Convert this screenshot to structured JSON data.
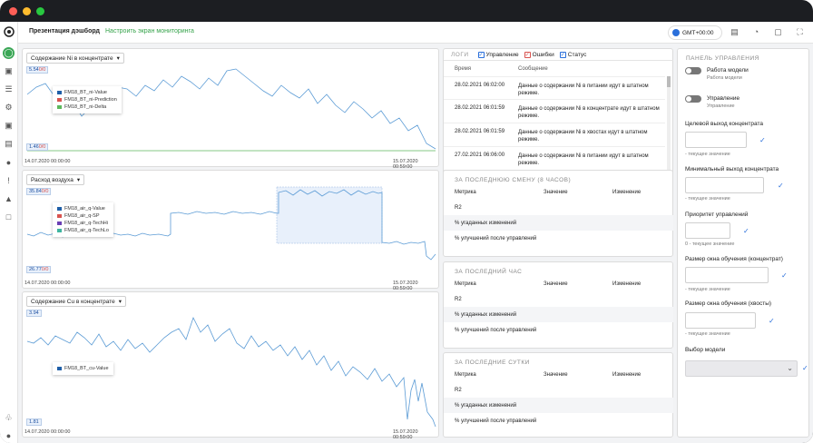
{
  "topbar": {
    "title": "Презентация дэшборд",
    "link": "Настроить экран мониторинга",
    "timezone": "GMT+00:00"
  },
  "charts": [
    {
      "select_label": "Содержание Ni в концентрате",
      "y_top": "5.54",
      "y_top_suffix": "0/0",
      "y_bottom": "1.46",
      "y_bottom_suffix": "0/0",
      "x_start": "14.07.2020 00:00:00",
      "x_end": "15.07.2020 00:59:00",
      "legend": [
        {
          "name": "FM18_BT_ni-Value",
          "color": "#1f5fa8"
        },
        {
          "name": "FM18_BT_ni-Prediction",
          "color": "#d9534f"
        },
        {
          "name": "FM18_BT_ni-Delta",
          "color": "#5cb85c"
        }
      ]
    },
    {
      "select_label": "Расход воздуха",
      "y_top": "35.84",
      "y_top_suffix": "0/0",
      "y_bottom": "26.77",
      "y_bottom_suffix": "0/0",
      "x_start": "14.07.2020 00:00:00",
      "x_end": "15.07.2020 00:59:00",
      "legend": [
        {
          "name": "FM18_air_q-Value",
          "color": "#1f5fa8"
        },
        {
          "name": "FM18_air_q-SP",
          "color": "#d9534f"
        },
        {
          "name": "FM18_air_q-TechHi",
          "color": "#6a3fb5"
        },
        {
          "name": "FM18_air_q-TechLo",
          "color": "#3fb5a0"
        }
      ]
    },
    {
      "select_label": "Содержание Cu в концентрате",
      "y_top": "3.94",
      "y_top_suffix": "",
      "y_bottom": "1.81",
      "y_bottom_suffix": "",
      "x_start": "14.07.2020 00:00:00",
      "x_end": "15.07.2020 00:59:00",
      "legend": [
        {
          "name": "FM18_BT_cu-Value",
          "color": "#1f5fa8"
        }
      ]
    }
  ],
  "logs": {
    "tab": "ЛОГИ",
    "filters": [
      {
        "label": "Управление",
        "color": "#2a6fdb"
      },
      {
        "label": "Ошибки",
        "color": "#d9534f"
      },
      {
        "label": "Статус",
        "color": "#2a6fdb"
      }
    ],
    "col_time": "Время",
    "col_msg": "Сообщение",
    "rows": [
      {
        "time": "28.02.2021 06:02:00",
        "msg": "Данные о содержании Ni в питании идут в штатном режиме."
      },
      {
        "time": "28.02.2021 06:01:59",
        "msg": "Данные о содержании Ni в концентрате идут в штатном режиме."
      },
      {
        "time": "28.02.2021 06:01:59",
        "msg": "Данные о содержании Ni в хвостах идут в штатном режиме."
      },
      {
        "time": "27.02.2021 06:06:00",
        "msg": "Данные о содержании Ni в питании идут в штатном режиме."
      }
    ]
  },
  "metrics": [
    {
      "title": "ЗА ПОСЛЕДНЮЮ СМЕНУ (8 ЧАСОВ)",
      "col_metric": "Метрика",
      "col_value": "Значение",
      "col_change": "Изменение",
      "rows": [
        "R2",
        "% угаданных изменений",
        "% улучшений после управлений"
      ]
    },
    {
      "title": "ЗА ПОСЛЕДНИЙ ЧАС",
      "col_metric": "Метрика",
      "col_value": "Значение",
      "col_change": "Изменение",
      "rows": [
        "R2",
        "% угаданных изменений",
        "% улучшений после управлений"
      ]
    },
    {
      "title": "ЗА ПОСЛЕДНИЕ СУТКИ",
      "col_metric": "Метрика",
      "col_value": "Значение",
      "col_change": "Изменение",
      "rows": [
        "R2",
        "% угаданных изменений",
        "% улучшений после управлений"
      ]
    }
  ],
  "control": {
    "title": "ПАНЕЛЬ УПРАВЛЕНИЯ",
    "toggles": [
      {
        "label": "Работа модели",
        "sub": "Работа модели"
      },
      {
        "label": "Управление",
        "sub": "Управление"
      }
    ],
    "fields": [
      {
        "label": "Целевой выход концентрата",
        "sub": "- текущее значение"
      },
      {
        "label": "Минимальный выход концентрата",
        "sub": "- текущее значение"
      },
      {
        "label": "Приоритет управлений",
        "sub": "0 - текущее значение"
      },
      {
        "label": "Размер окна обучения (концентрат)",
        "sub": "- текущее значение"
      },
      {
        "label": "Размер окна обучения (хвосты)",
        "sub": "- текущее значение"
      }
    ],
    "model_label": "Выбор модели"
  }
}
